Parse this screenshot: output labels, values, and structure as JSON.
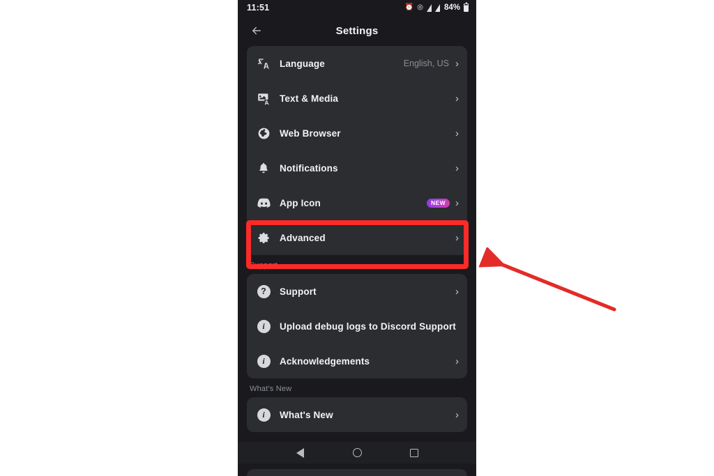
{
  "status_bar": {
    "time": "11:51",
    "battery_percent": "84%",
    "icons": [
      "alarm-icon",
      "cast-icon",
      "signal-icon",
      "signal-icon",
      "battery-icon"
    ]
  },
  "header": {
    "back_icon": "back-arrow-icon",
    "title": "Settings"
  },
  "app_settings": {
    "items": [
      {
        "icon": "translate-icon",
        "label": "Language",
        "value": "English, US",
        "chevron": true,
        "badge": ""
      },
      {
        "icon": "text-media-icon",
        "label": "Text & Media",
        "value": "",
        "chevron": true,
        "badge": ""
      },
      {
        "icon": "globe-icon",
        "label": "Web Browser",
        "value": "",
        "chevron": true,
        "badge": ""
      },
      {
        "icon": "bell-icon",
        "label": "Notifications",
        "value": "",
        "chevron": true,
        "badge": ""
      },
      {
        "icon": "discord-icon",
        "label": "App Icon",
        "value": "",
        "chevron": true,
        "badge": "NEW"
      },
      {
        "icon": "gear-icon",
        "label": "Advanced",
        "value": "",
        "chevron": true,
        "badge": ""
      }
    ]
  },
  "support": {
    "section_label": "Support",
    "items": [
      {
        "icon": "question-circle-icon",
        "label": "Support",
        "chevron": true
      },
      {
        "icon": "info-circle-icon",
        "label": "Upload debug logs to Discord Support",
        "chevron": false
      },
      {
        "icon": "info-circle-icon",
        "label": "Acknowledgements",
        "chevron": true
      }
    ]
  },
  "whats_new": {
    "section_label": "What's New",
    "items": [
      {
        "icon": "info-circle-icon",
        "label": "What's New",
        "chevron": true
      }
    ]
  },
  "nav_bar": {
    "back": "nav-back-icon",
    "home": "nav-home-icon",
    "recents": "nav-recents-icon"
  },
  "annotation": {
    "highlight_target": "Advanced",
    "highlight_color": "#fa2b28",
    "arrow_color": "#e32b28"
  },
  "glyphs": {
    "chevron": "›",
    "back_arrow": "←",
    "alarm": "⏰",
    "cast": "◎",
    "question": "?",
    "info": "i"
  }
}
